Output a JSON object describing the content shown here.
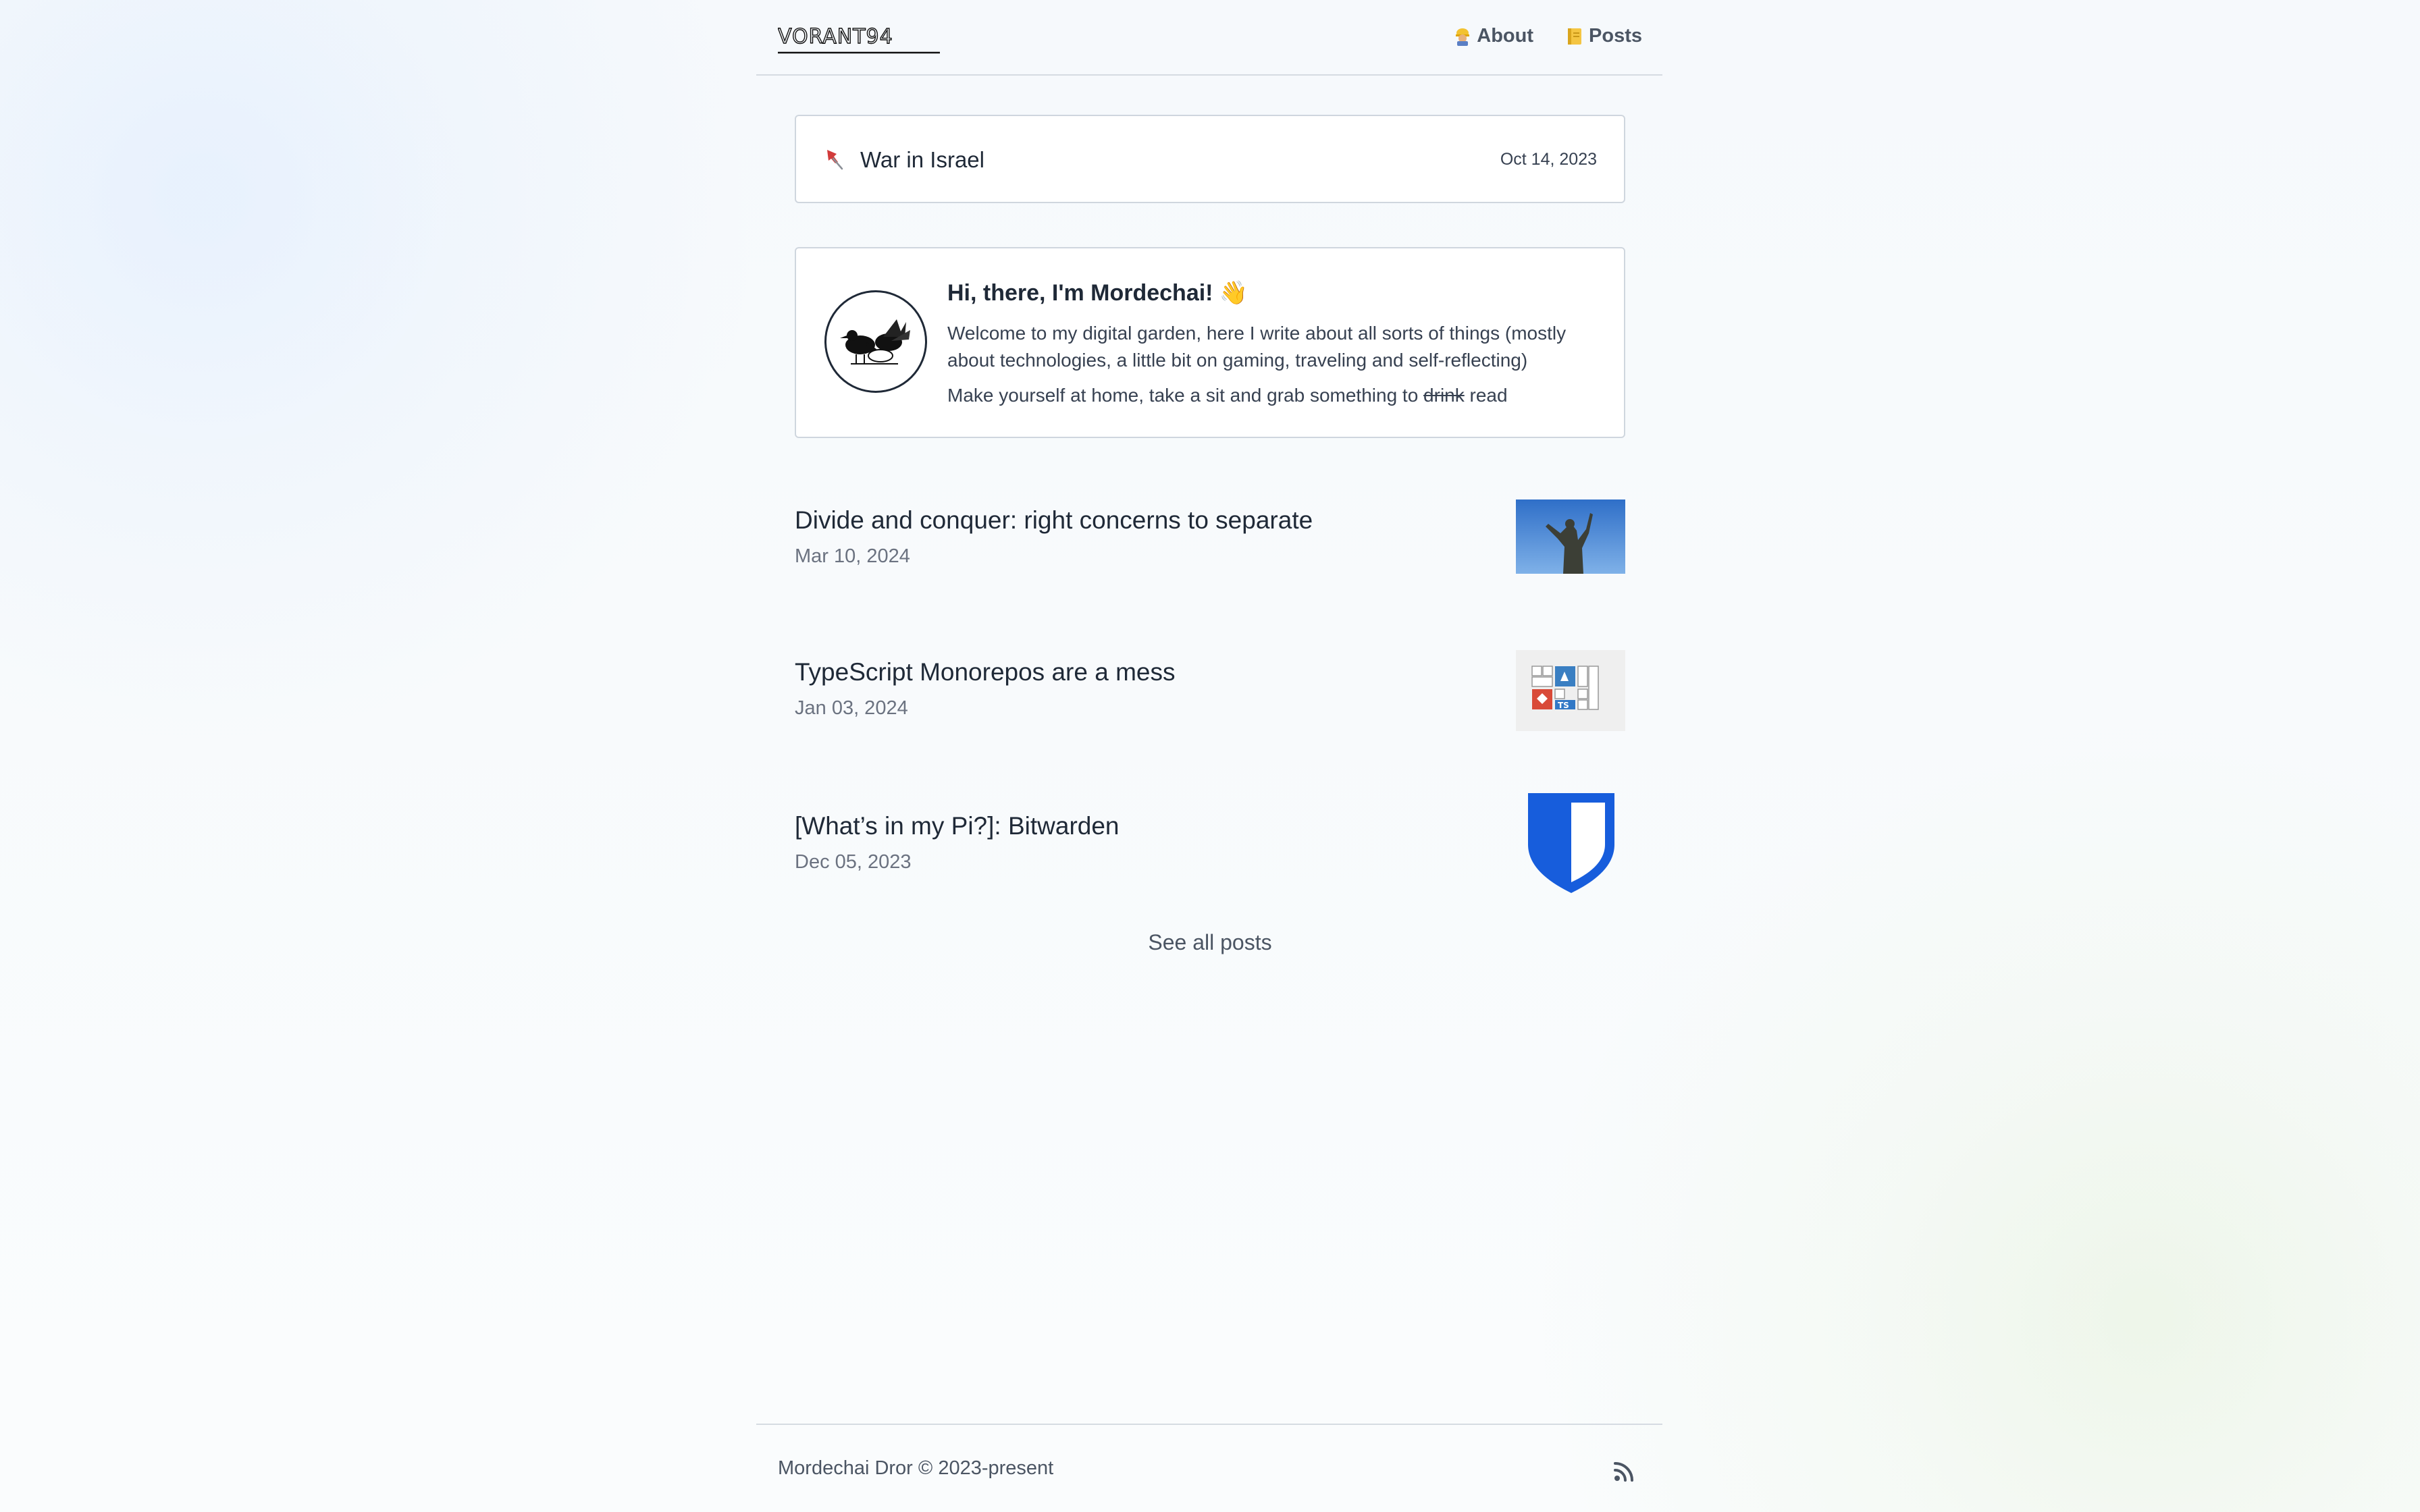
{
  "header": {
    "logo_text": "VORANT94",
    "nav": [
      {
        "label": "About",
        "icon": "construction-worker-emoji"
      },
      {
        "label": "Posts",
        "icon": "notebook-emoji"
      }
    ]
  },
  "pinned": {
    "icon": "pushpin-icon",
    "title": "War in Israel",
    "date": "Oct 14, 2023"
  },
  "intro": {
    "title": "Hi, there, I'm Mordechai! 👋",
    "text1": "Welcome to my digital garden, here I write about all sorts of things (mostly about technologies, a little bit on gaming, traveling and self-reflecting)",
    "text2_before": "Make yourself at home, take a sit and grab something to ",
    "text2_struck": "drink",
    "text2_after": " read"
  },
  "posts": [
    {
      "title": "Divide and conquer: right concerns to separate",
      "date": "Mar 10, 2024",
      "thumbnail": "statue-photo"
    },
    {
      "title": "TypeScript Monorepos are a mess",
      "date": "Jan 03, 2024",
      "thumbnail": "monorepo-diagram"
    },
    {
      "title": "[What’s in my Pi?]: Bitwarden",
      "date": "Dec 05, 2023",
      "thumbnail": "bitwarden-shield-logo"
    }
  ],
  "see_all_label": "See all posts",
  "footer": {
    "copyright": "Mordechai Dror © 2023-present",
    "rss_icon": "rss-icon"
  },
  "colors": {
    "text": "#1f2937",
    "muted": "#6b7280",
    "border": "#cfd6de",
    "bitwarden_blue": "#175DDC"
  }
}
